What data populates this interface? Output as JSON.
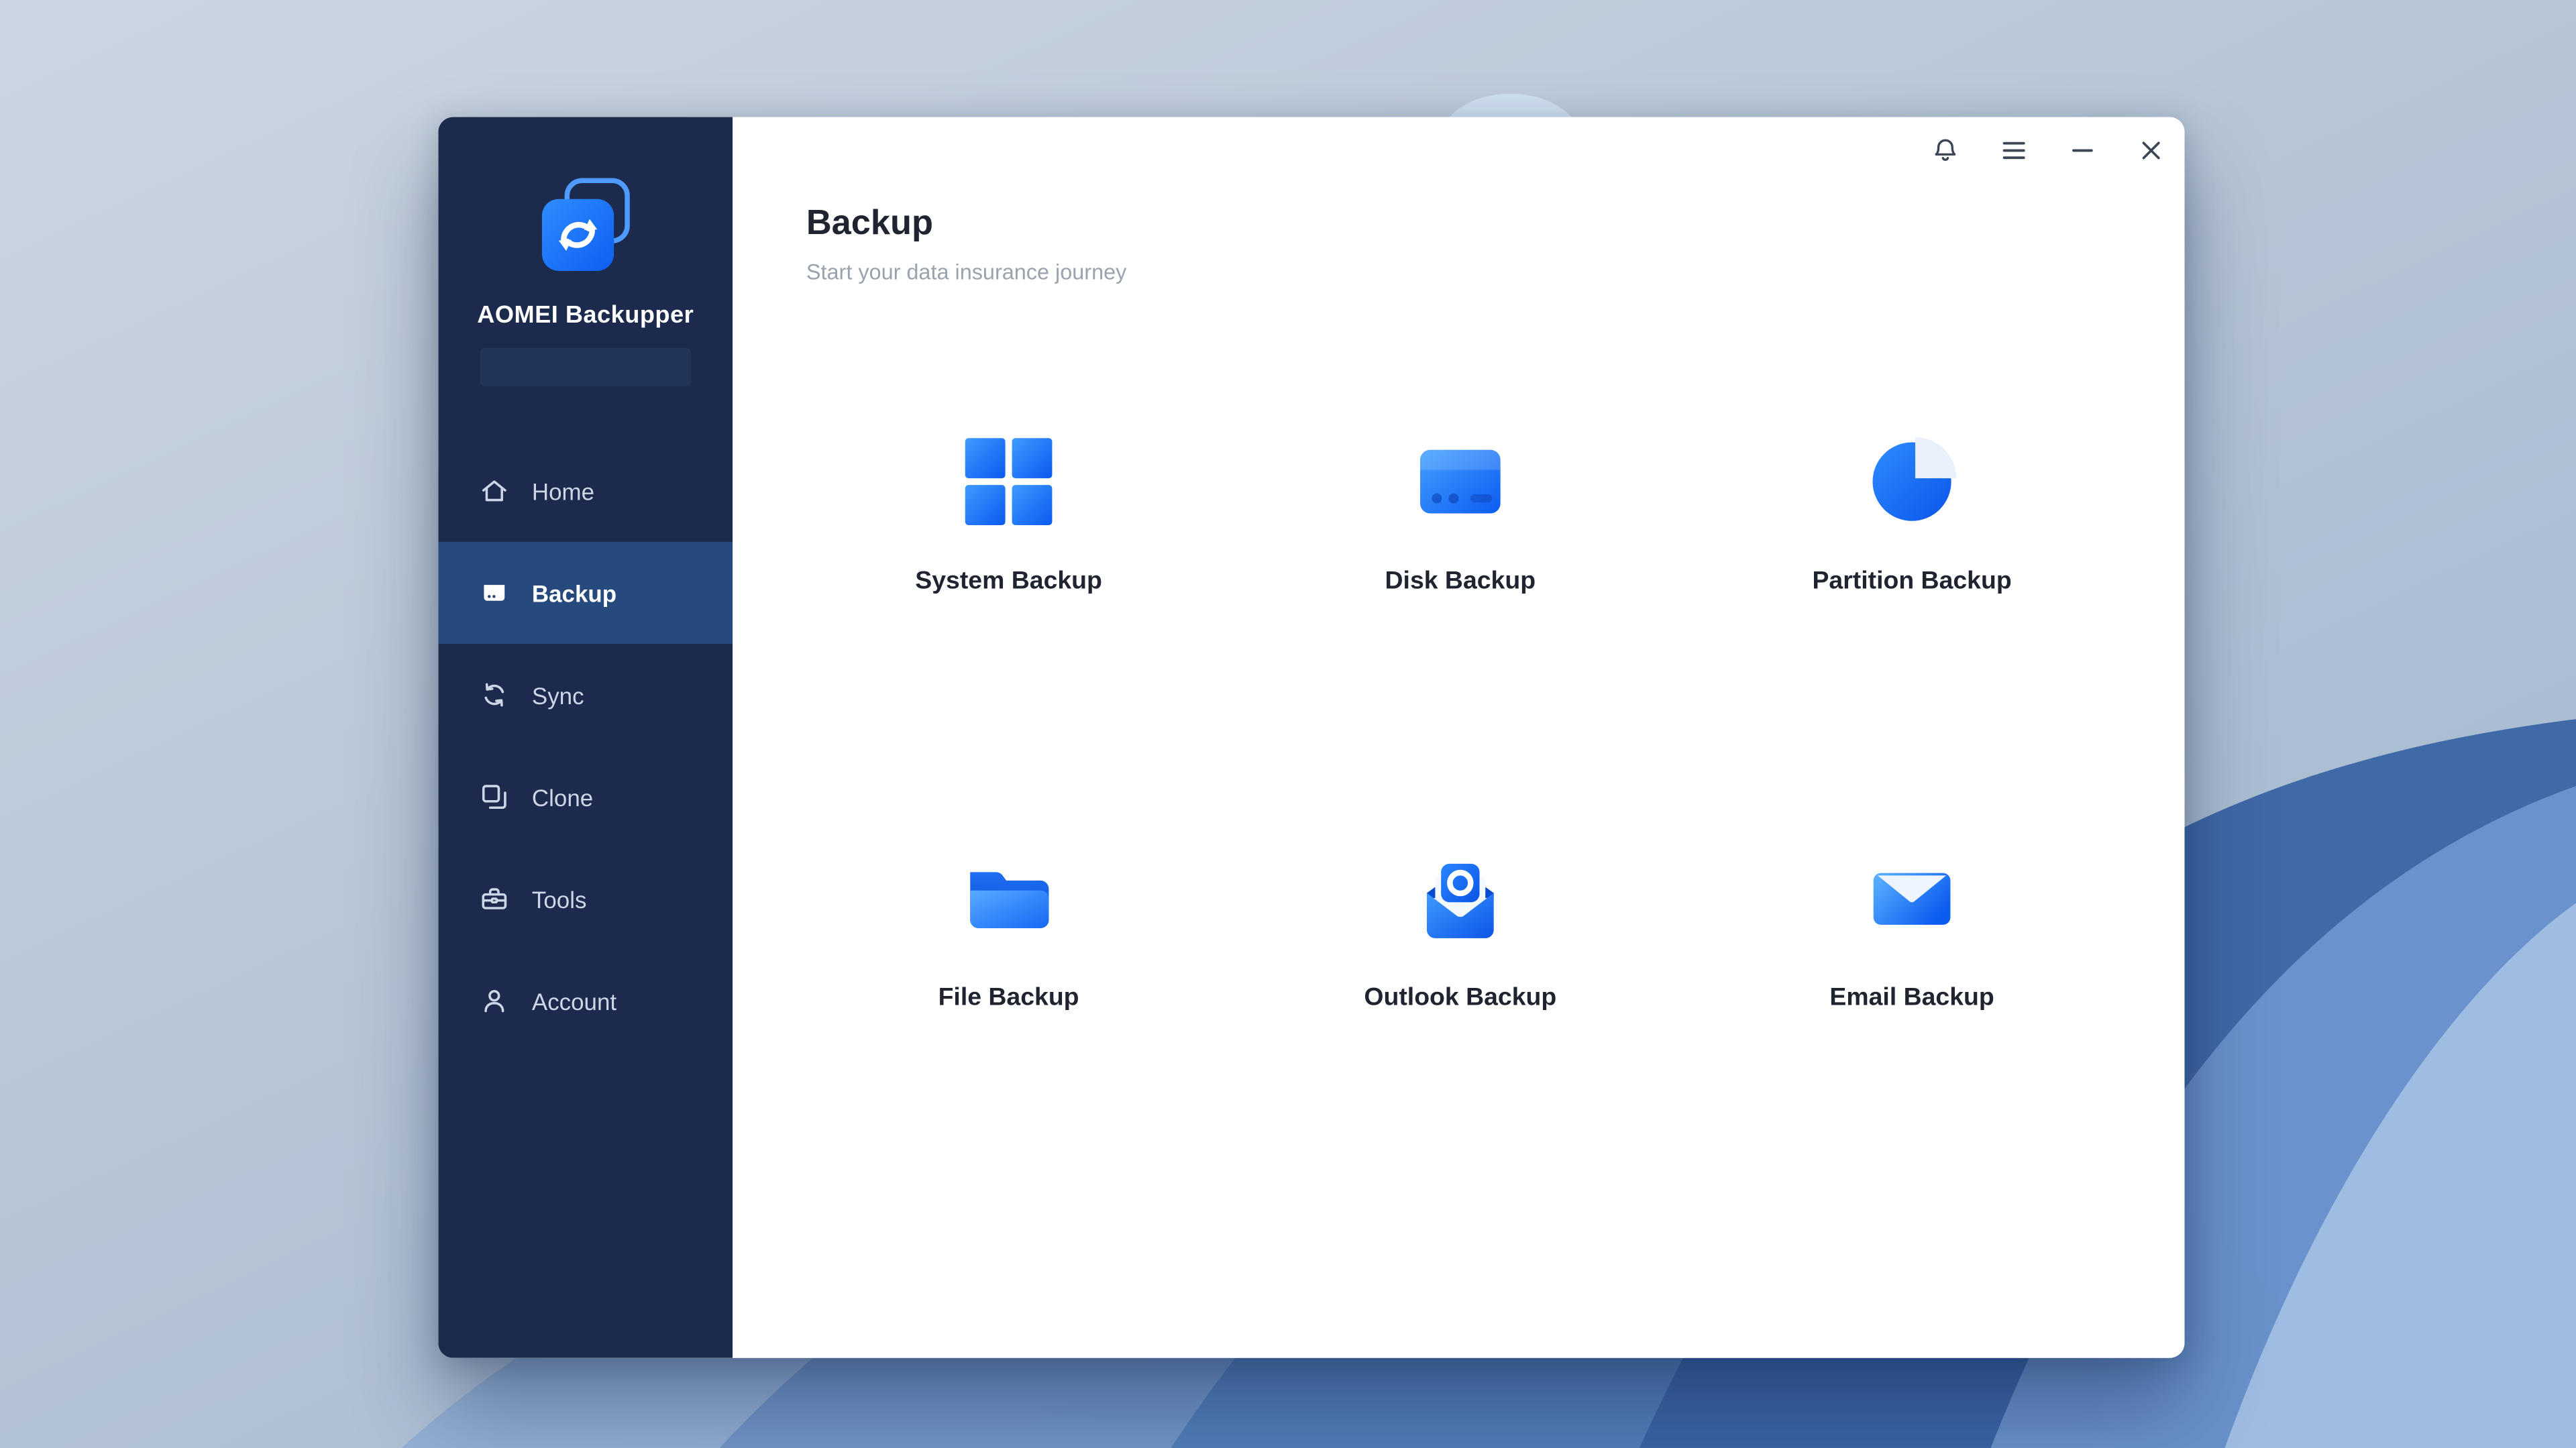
{
  "window": {
    "titlebar": {
      "icons": [
        {
          "name": "bell"
        },
        {
          "name": "menu"
        },
        {
          "name": "minimize"
        },
        {
          "name": "close"
        }
      ]
    }
  },
  "sidebar": {
    "brand": "AOMEI Backupper",
    "items": [
      {
        "label": "Home",
        "icon": "home",
        "active": false
      },
      {
        "label": "Backup",
        "icon": "backup",
        "active": true
      },
      {
        "label": "Sync",
        "icon": "sync",
        "active": false
      },
      {
        "label": "Clone",
        "icon": "clone",
        "active": false
      },
      {
        "label": "Tools",
        "icon": "tools",
        "active": false
      },
      {
        "label": "Account",
        "icon": "account",
        "active": false
      }
    ]
  },
  "main": {
    "title": "Backup",
    "subtitle": "Start your data insurance journey",
    "tiles": [
      {
        "label": "System Backup",
        "icon": "system-backup"
      },
      {
        "label": "Disk Backup",
        "icon": "disk-backup"
      },
      {
        "label": "Partition Backup",
        "icon": "partition-backup"
      },
      {
        "label": "File Backup",
        "icon": "file-backup"
      },
      {
        "label": "Outlook Backup",
        "icon": "outlook-backup"
      },
      {
        "label": "Email Backup",
        "icon": "email-backup"
      }
    ]
  },
  "colors": {
    "accent": "#1569f2",
    "sidebar_bg": "#1c2b4d",
    "sidebar_active": "#26497e",
    "tile_label": "#1f2430",
    "subtitle": "#9aa3ad"
  }
}
